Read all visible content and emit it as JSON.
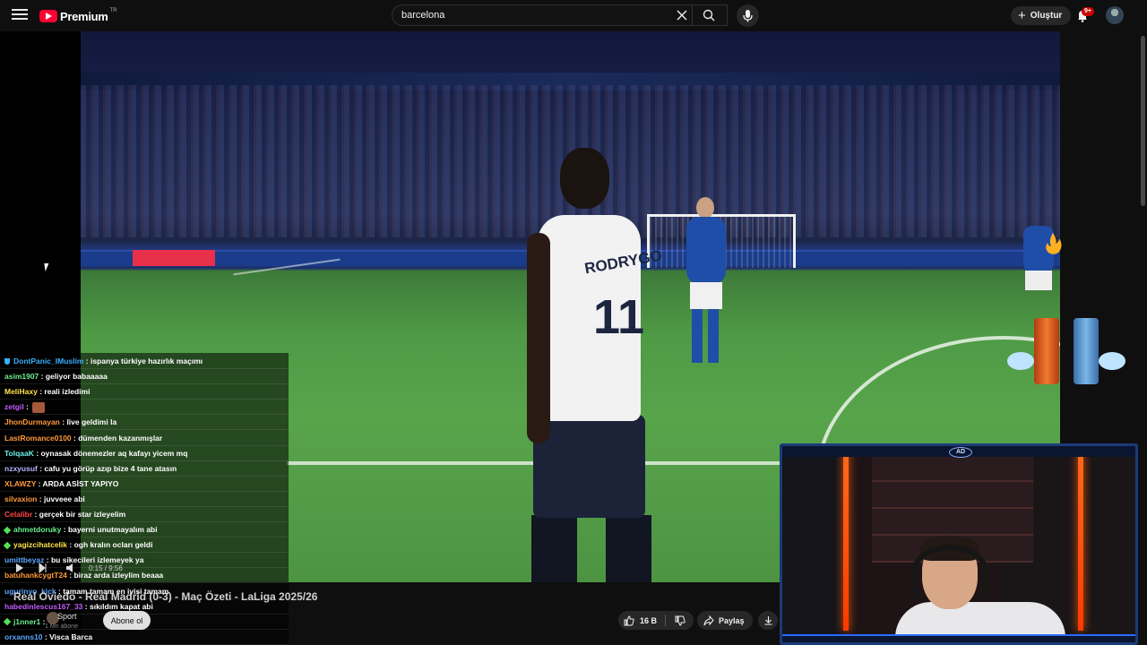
{
  "header": {
    "logo_text": "Premium",
    "logo_region": "TR",
    "search_value": "barcelona",
    "create_label": "Oluştur",
    "notification_count": "9+"
  },
  "video": {
    "title": "Real Oviedo - Real Madrid (0-3) - Maç Özeti - LaLiga 2025/26",
    "time": "0:15 / 9:56",
    "player_name": "RODRYGO",
    "player_number": "11"
  },
  "channel": {
    "name": "Sport",
    "subs": "1 Mn abone",
    "subscribe_label": "Abone ol"
  },
  "actions": {
    "like_count": "16 B",
    "share_label": "Paylaş"
  },
  "webcam": {
    "logo": "AD"
  },
  "chat": [
    {
      "user": "DontPanic_IMuslim",
      "msg": "ispanya türkiye hazırlık maçımı",
      "color": "#3ab0ff",
      "badge": "shield"
    },
    {
      "user": "asim1907",
      "msg": "geliyor babaaaaa",
      "color": "#6bf08c",
      "badge": ""
    },
    {
      "user": "MeliHaxy",
      "msg": "reali izledimi",
      "color": "#ffe34a",
      "badge": ""
    },
    {
      "user": "zetgil",
      "msg": "",
      "color": "#c35cff",
      "badge": "",
      "emote": true
    },
    {
      "user": "JhonDurmayan",
      "msg": "live geldimi la",
      "color": "#ff9a3c",
      "badge": ""
    },
    {
      "user": "LastRomance0100",
      "msg": "dümenden kazanmışlar",
      "color": "#ff9a3c",
      "badge": ""
    },
    {
      "user": "TolqaaK",
      "msg": "oynasak dönemezler aq kafayı yicem mq",
      "color": "#6bf0e8",
      "badge": ""
    },
    {
      "user": "nzxyusuf",
      "msg": "cafu yu görüp azıp bize 4 tane atasın",
      "color": "#b5b5ff",
      "badge": ""
    },
    {
      "user": "XLAWZY",
      "msg": "ARDA ASİST YAPIYO",
      "color": "#ff9a3c",
      "badge": ""
    },
    {
      "user": "silvaxion",
      "msg": "juvveee abi",
      "color": "#ff9a3c",
      "badge": ""
    },
    {
      "user": "Celalibr",
      "msg": "gerçek bir star izleyelim",
      "color": "#ff4a4a",
      "badge": ""
    },
    {
      "user": "ahmetdoruky",
      "msg": "bayerni unutmayalım abi",
      "color": "#6bf08c",
      "badge": "diamond"
    },
    {
      "user": "yagizcihatcelik",
      "msg": "ogh kralın ocları geldi",
      "color": "#ffe34a",
      "badge": "diamond"
    },
    {
      "user": "umittbeyaz",
      "msg": "bu sikecileri izlemeyek ya",
      "color": "#5ca8ff",
      "badge": ""
    },
    {
      "user": "batuhankcygtT24",
      "msg": "biraz arda izleylim beaaa",
      "color": "#ff9a3c",
      "badge": ""
    },
    {
      "user": "ugurinyo_kick",
      "msg": "tamam tamam en iyisi tamam",
      "color": "#5ca8ff",
      "badge": ""
    },
    {
      "user": "habedinlescus167_33",
      "msg": "sıkıldım kapat abi",
      "color": "#c35cff",
      "badge": ""
    },
    {
      "user": "j1nner1",
      "msg": "",
      "color": "#6bf08c",
      "badge": "diamond"
    },
    {
      "user": "orxanns10",
      "msg": "Visca Barca",
      "color": "#5ca8ff",
      "badge": ""
    }
  ]
}
